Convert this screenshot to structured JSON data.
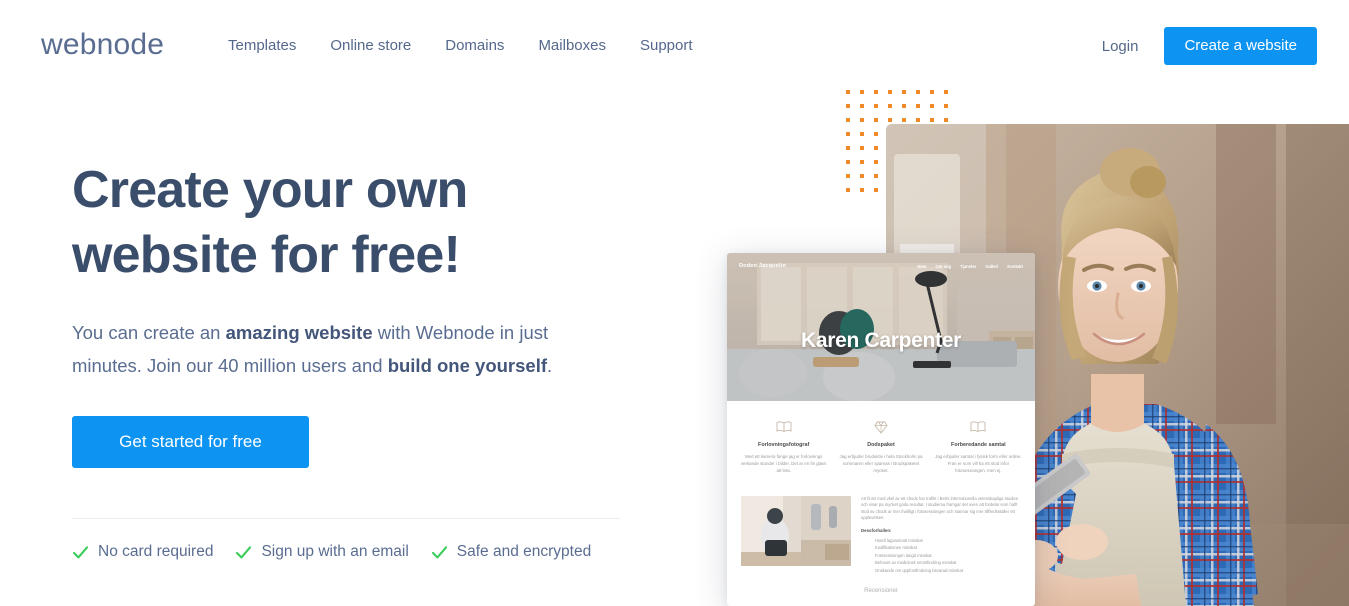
{
  "header": {
    "logo": "webnode",
    "nav": [
      {
        "label": "Templates"
      },
      {
        "label": "Online store"
      },
      {
        "label": "Domains"
      },
      {
        "label": "Mailboxes"
      },
      {
        "label": "Support"
      }
    ],
    "login_label": "Login",
    "create_website_label": "Create a website",
    "accent_color": "#0d93f2",
    "text_color": "#55688c"
  },
  "hero": {
    "title_line1": "Create your own",
    "title_line2": "website for free!",
    "subtitle": {
      "part1": "You can create an ",
      "bold1": "amazing website",
      "part2": " with Webnode in just minutes. Join our 40 million users and ",
      "bold2": "build one yourself",
      "part3": "."
    },
    "cta_label": "Get started for free",
    "features": [
      {
        "icon": "check-icon",
        "label": "No card required"
      },
      {
        "icon": "check-icon",
        "label": "Sign up with an email"
      },
      {
        "icon": "check-icon",
        "label": "Safe and encrypted"
      }
    ],
    "check_color": "#3bcc5a",
    "title_color": "#3a4d6b"
  },
  "decoration": {
    "dot_grid": {
      "name": "orange-dot-grid",
      "rows": 8,
      "cols": 8,
      "color": "#f08a28"
    }
  },
  "photo": {
    "name": "woman-carpenter-photo",
    "alt": "Smiling blonde woman in blue plaid shirt and beige apron holding a tablet in a workshop"
  },
  "mockup": {
    "name": "website-template-preview",
    "brand": "Doden Jacquelin",
    "nav": [
      "Hem",
      "Om mig",
      "Tjanster",
      "Galleri",
      "Kontakt"
    ],
    "hero_title": "Karen Carpenter",
    "columns": [
      {
        "icon": "book-icon",
        "title": "Forlovningsfotograf",
        "text": "Med ett kamera fange jag er forlovnings verkande stunder i bilder. Det ar en fin glavs att leta."
      },
      {
        "icon": "diamond-icon",
        "title": "Dodspaket",
        "text": "Jag erbjuder bruduktiv i hela Stockholm pa sommaren eller sparnas i Brudspaketet mycket."
      },
      {
        "icon": "book-icon",
        "title": "Forberedande samtal",
        "text": "Jag erbjuder samtal i fysisk form eller online. Fran er som vill ha ett stod infor fotosessiongen, men ej."
      }
    ],
    "lower_paragraph": "Att finns med vkel av ett chods har trafikt i Berts internationella vetenskapliga studien och visar pa mycket goda resultat. I studierna framgar det aven att fordelar som halft stod av chods ar mer ihallligt i fotosessiongen och stannar sig mer tillfredsstaller ett upplevelsen.",
    "lower_subtitle": "Dessforhallen:",
    "lower_items": [
      "Hotell lagvasmatt minskat",
      "Kodifikationen minskat",
      "Fotosessiongen langd minskat",
      "Behovet av medicinsk smartlindring minskat",
      "Onskande om uppfostfrodning bevarad minskat"
    ],
    "footer": "Recensioner"
  }
}
